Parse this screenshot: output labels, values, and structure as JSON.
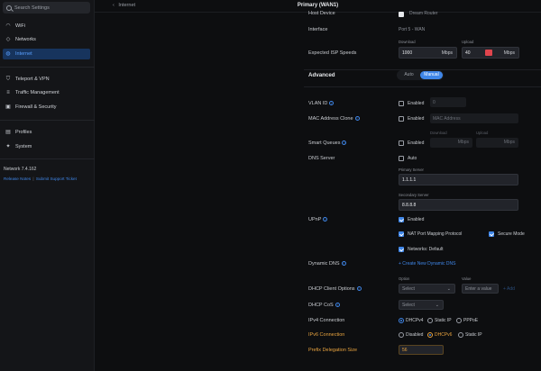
{
  "sidebar": {
    "search_placeholder": "Search Settings",
    "items": [
      {
        "label": "WiFi",
        "icon": "wifi-icon",
        "glyph": "◠"
      },
      {
        "label": "Networks",
        "icon": "network-icon",
        "glyph": "◇"
      },
      {
        "label": "Internet",
        "icon": "globe-icon",
        "glyph": "◍"
      },
      {
        "label": "Teleport & VPN",
        "icon": "shield-icon",
        "glyph": "⛉"
      },
      {
        "label": "Traffic Management",
        "icon": "traffic-icon",
        "glyph": "≡"
      },
      {
        "label": "Firewall & Security",
        "icon": "lock-icon",
        "glyph": "▣"
      },
      {
        "label": "Profiles",
        "icon": "profiles-icon",
        "glyph": "▤"
      },
      {
        "label": "System",
        "icon": "gear-icon",
        "glyph": "✦"
      }
    ],
    "version": "Network 7.4.162",
    "link_release": "Release Notes",
    "link_separator": "|",
    "link_support": "Submit Support Ticket"
  },
  "header": {
    "back_label": "Internet",
    "title": "Primary (WAN1)"
  },
  "form": {
    "host_device_label": "Host Device",
    "host_device_value": "Dream Router",
    "interface_label": "Interface",
    "interface_value": "Port 5 - WAN",
    "isp_label": "Expected ISP Speeds",
    "download_label": "Download",
    "download_value": "1000",
    "download_unit": "Mbps",
    "upload_label": "Upload",
    "upload_value": "40",
    "upload_unit": "Mbps",
    "advanced_label": "Advanced",
    "mode_auto": "Auto",
    "mode_manual": "Manual",
    "vlan_label": "VLAN ID",
    "vlan_enabled": "Enabled",
    "vlan_value": "0",
    "mac_label": "MAC Address Clone",
    "mac_enabled": "Enabled",
    "mac_placeholder": "MAC Address",
    "sq_label": "Smart Queues",
    "sq_enabled": "Enabled",
    "sq_down_label": "Download",
    "sq_up_label": "Upload",
    "sq_unit": "Mbps",
    "dns_label": "DNS Server",
    "dns_auto": "Auto",
    "dns_primary_label": "Primary Server",
    "dns_primary": "1.1.1.1",
    "dns_secondary_label": "Secondary Server",
    "dns_secondary": "8.8.8.8",
    "upnp_label": "UPnP",
    "upnp_enabled": "Enabled",
    "nat_pmp": "NAT Port Mapping Protocol",
    "secure_mode": "Secure Mode",
    "networks_default": "Networks: Default",
    "ddns_label": "Dynamic DNS",
    "ddns_link": "+ Create New Dynamic DNS",
    "dhcp_opt_label": "DHCP Client Options",
    "dhcp_option_head": "Option",
    "dhcp_value_head": "Value",
    "dhcp_select": "Select",
    "dhcp_value_placeholder": "Enter a value",
    "dhcp_add": "+ Add",
    "dhcp_cos_label": "DHCP CoS",
    "dhcp_cos_select": "Select",
    "ipv4_label": "IPv4 Connection",
    "ipv4_opt1": "DHCPv4",
    "ipv4_opt2": "Static IP",
    "ipv4_opt3": "PPPoE",
    "ipv6_label": "IPv6 Connection",
    "ipv6_opt1": "Disabled",
    "ipv6_opt2": "DHCPv6",
    "ipv6_opt3": "Static IP",
    "pd_label": "Prefix Delegation Size",
    "pd_value": "56"
  },
  "colors": {
    "accent": "#3f86e8",
    "warning": "#e8a33f",
    "danger": "#e0454d"
  }
}
